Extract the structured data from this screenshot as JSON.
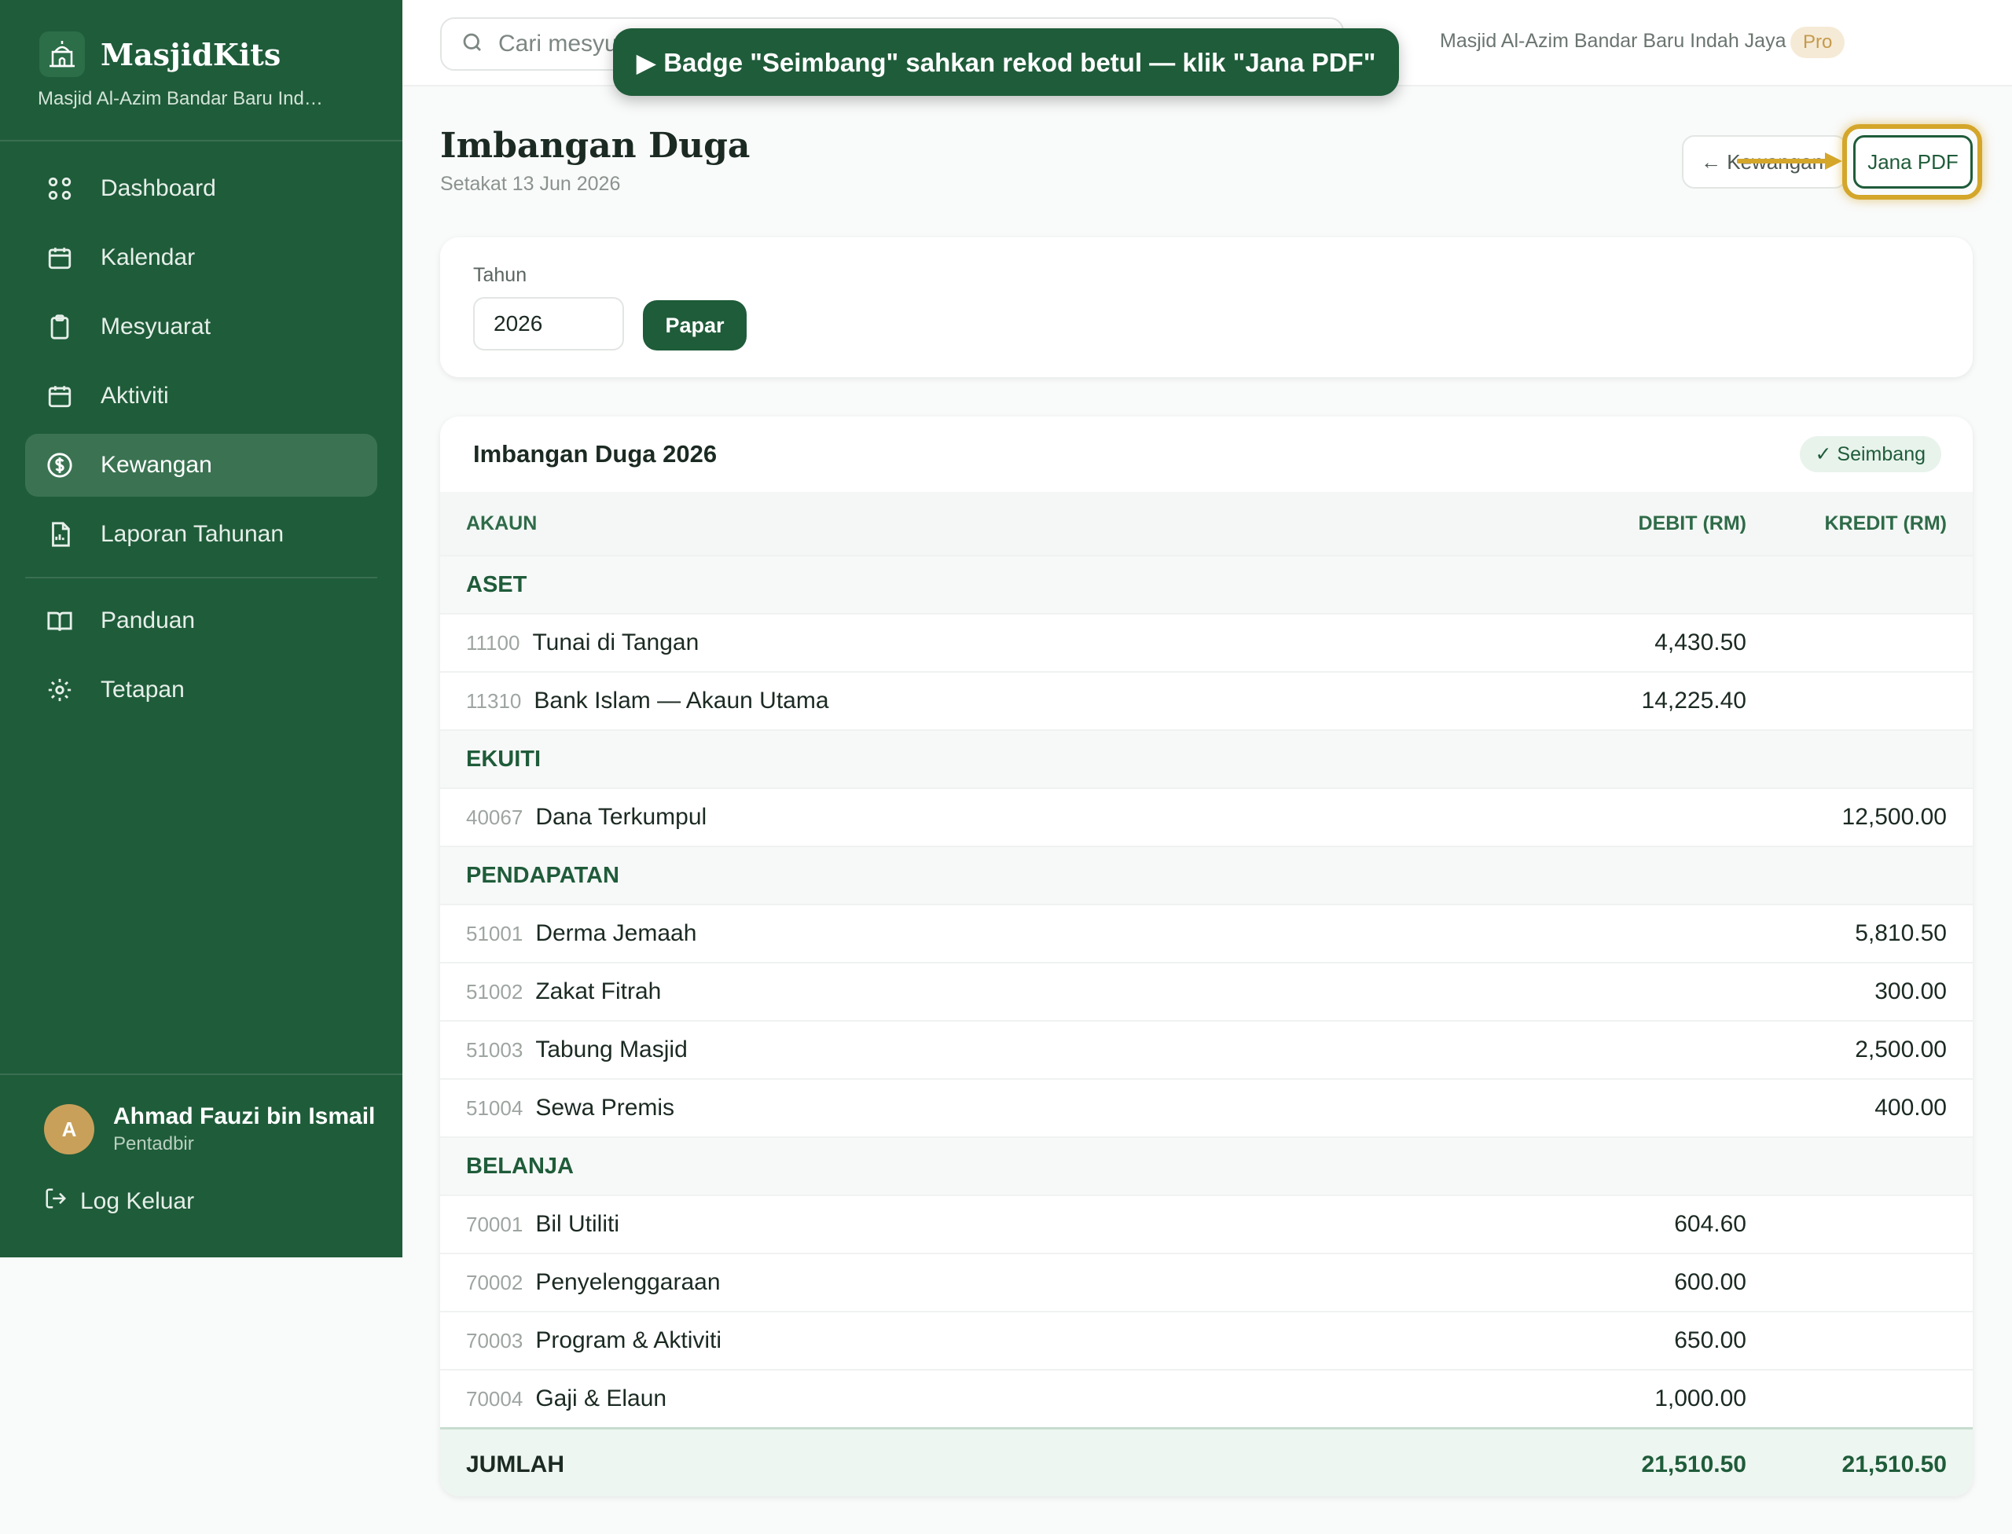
{
  "brand": {
    "name": "MasjidKits",
    "subtitle": "Masjid Al-Azim Bandar Baru Indah J..."
  },
  "nav": [
    {
      "label": "Dashboard",
      "icon": "grid-icon"
    },
    {
      "label": "Kalendar",
      "icon": "calendar-icon"
    },
    {
      "label": "Mesyuarat",
      "icon": "clipboard-icon"
    },
    {
      "label": "Aktiviti",
      "icon": "calendar-icon"
    },
    {
      "label": "Kewangan",
      "icon": "dollar-icon",
      "active": true
    },
    {
      "label": "Laporan Tahunan",
      "icon": "report-icon"
    },
    {
      "label": "Panduan",
      "icon": "book-icon"
    },
    {
      "label": "Tetapan",
      "icon": "gear-icon"
    }
  ],
  "user": {
    "initial": "A",
    "name": "Ahmad Fauzi bin Ismail",
    "role": "Pentadbir",
    "logout": "Log Keluar"
  },
  "topbar": {
    "search_placeholder": "Cari mesyu",
    "org": "Masjid Al-Azim Bandar Baru Indah Jaya",
    "plan": "Pro"
  },
  "toast": "▶ Badge \"Seimbang\" sahkan rekod betul — klik \"Jana PDF\"",
  "header": {
    "title": "Imbangan Duga",
    "subtitle": "Setakat 13 Jun 2026",
    "back_label": "← Kewangan",
    "pdf_label": "Jana PDF"
  },
  "filter": {
    "label": "Tahun",
    "value": "2026",
    "button": "Papar"
  },
  "table": {
    "title": "Imbangan Duga 2026",
    "badge": "✓ Seimbang",
    "columns": {
      "account": "AKAUN",
      "debit": "DEBIT (RM)",
      "credit": "KREDIT (RM)"
    },
    "groups": [
      {
        "name": "ASET",
        "rows": [
          {
            "code": "11100",
            "name": "Tunai di Tangan",
            "debit": "4,430.50",
            "credit": ""
          },
          {
            "code": "11310",
            "name": "Bank Islam — Akaun Utama",
            "debit": "14,225.40",
            "credit": ""
          }
        ]
      },
      {
        "name": "EKUITI",
        "rows": [
          {
            "code": "40067",
            "name": "Dana Terkumpul",
            "debit": "",
            "credit": "12,500.00"
          }
        ]
      },
      {
        "name": "PENDAPATAN",
        "rows": [
          {
            "code": "51001",
            "name": "Derma Jemaah",
            "debit": "",
            "credit": "5,810.50"
          },
          {
            "code": "51002",
            "name": "Zakat Fitrah",
            "debit": "",
            "credit": "300.00"
          },
          {
            "code": "51003",
            "name": "Tabung Masjid",
            "debit": "",
            "credit": "2,500.00"
          },
          {
            "code": "51004",
            "name": "Sewa Premis",
            "debit": "",
            "credit": "400.00"
          }
        ]
      },
      {
        "name": "BELANJA",
        "rows": [
          {
            "code": "70001",
            "name": "Bil Utiliti",
            "debit": "604.60",
            "credit": ""
          },
          {
            "code": "70002",
            "name": "Penyelenggaraan",
            "debit": "600.00",
            "credit": ""
          },
          {
            "code": "70003",
            "name": "Program & Aktiviti",
            "debit": "650.00",
            "credit": ""
          },
          {
            "code": "70004",
            "name": "Gaji & Elaun",
            "debit": "1,000.00",
            "credit": ""
          }
        ]
      }
    ],
    "total": {
      "label": "JUMLAH",
      "debit": "21,510.50",
      "credit": "21,510.50"
    }
  },
  "colors": {
    "primary": "#1f5c3a",
    "highlight": "#d4a62a",
    "pro_badge": "#f5ead6"
  }
}
